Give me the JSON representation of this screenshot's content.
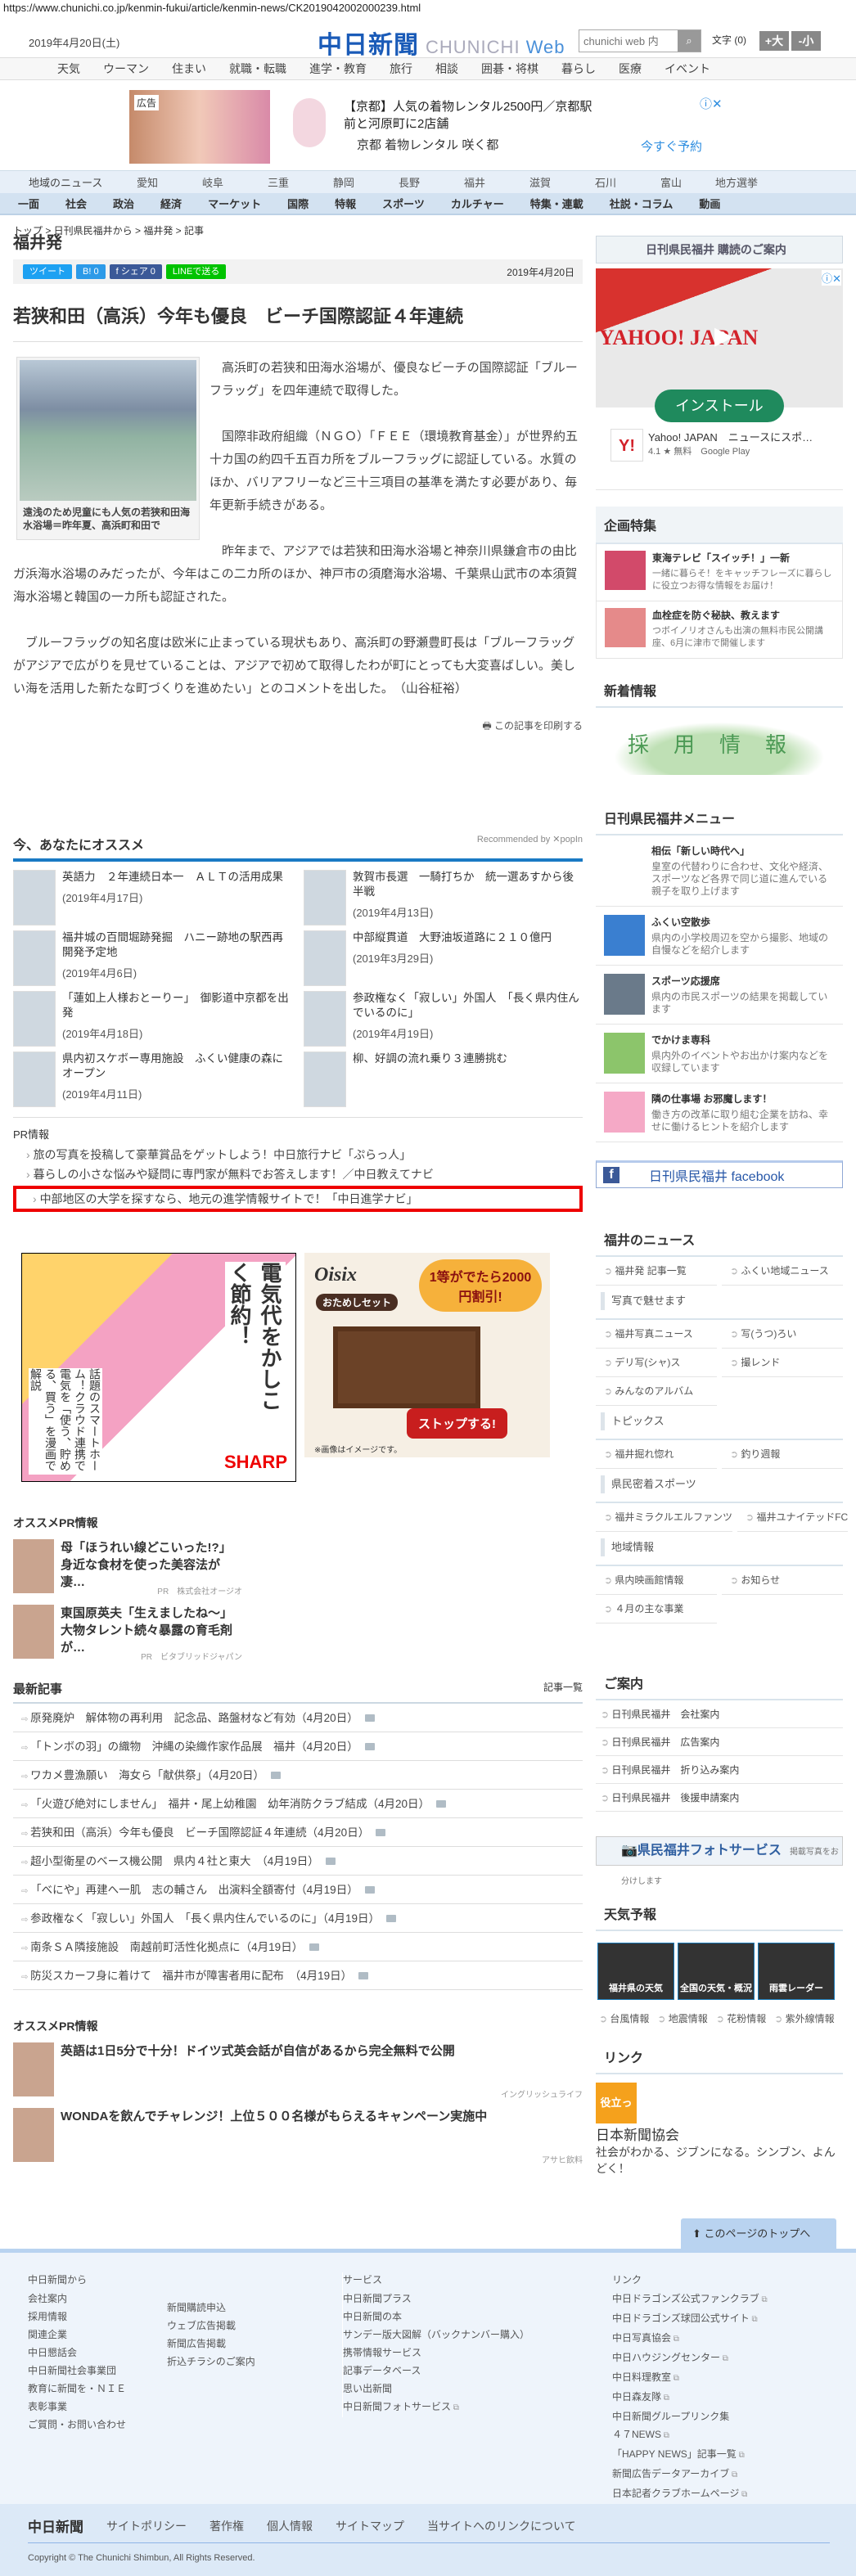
{
  "url": "https://www.chunichi.co.jp/kenmin-fukui/article/kenmin-news/CK2019042002000239.html",
  "header": {
    "date": "2019年4月20日(土)",
    "logo": "中日新聞",
    "logo_sub": "CHUNICHI",
    "logo_web": "Web",
    "search_placeholder": "chunichi web 内",
    "font_label": "文字 (0)",
    "bigger": "+大",
    "smaller": "-小"
  },
  "top_nav": [
    "天気",
    "ウーマン",
    "住まい",
    "就職・転職",
    "進学・教育",
    "旅行",
    "相談",
    "囲碁・将棋",
    "暮らし",
    "医療",
    "イベント"
  ],
  "top_ad": {
    "badge": "広告",
    "text": "【京都】人気の着物レンタル2500円／京都駅前と河原町に2店舗",
    "advertiser": "京都 着物レンタル 咲く都",
    "cta": "今すぐ予約"
  },
  "region_nav": {
    "label": "地域のニュース",
    "items": [
      "愛知",
      "岐阜",
      "三重",
      "静岡",
      "長野",
      "福井",
      "滋賀",
      "石川",
      "富山",
      "地方選挙"
    ]
  },
  "category_nav": [
    "一面",
    "社会",
    "政治",
    "経済",
    "マーケット",
    "国際",
    "特報",
    "スポーツ",
    "カルチャー",
    "特集・連載",
    "社説・コラム",
    "動画"
  ],
  "breadcrumb": "トップ > 日刊県民福井から > 福井発 > 記事",
  "section_title": "福井発",
  "share": {
    "tweet": "ツイート",
    "hatena": "B! 0",
    "facebook": "f シェア 0",
    "line": "LINEで送る",
    "date": "2019年4月20日"
  },
  "article": {
    "title": "若狭和田（高浜）今年も優良　ビーチ国際認証４年連続",
    "caption": "遠浅のため児童にも人気の若狭和田海水浴場＝昨年夏、高浜町和田で",
    "paragraphs": [
      "高浜町の若狭和田海水浴場が、優良なビーチの国際認証「ブルーフラッグ」を四年連続で取得した。",
      "国際非政府組織（ＮＧＯ）「ＦＥＥ（環境教育基金）」が世界約五十カ国の約四千五百カ所をブルーフラッグに認証している。水質のほか、バリアフリーなど三十三項目の基準を満たす必要があり、毎年更新手続きがある。",
      "昨年まで、アジアでは若狭和田海水浴場と神奈川県鎌倉市の由比ガ浜海水浴場のみだったが、今年はこの二カ所のほか、神戸市の須磨海水浴場、千葉県山武市の本須賀海水浴場と韓国の一カ所も認証された。",
      "ブルーフラッグの知名度は欧米に止まっている現状もあり、高浜町の野瀬豊町長は「ブルーフラッグがアジアで広がりを見せていることは、アジアで初めて取得したわが町にとっても大変喜ばしい。美しい海を活用した新たな町づくりを進めたい」とのコメントを出した。　（山谷柾裕）"
    ],
    "print": "この記事を印刷する"
  },
  "recommend": {
    "title": "今、あなたにオススメ",
    "by": "Recommended by ✕popIn",
    "items": [
      {
        "title": "英語力　２年連続日本一　ＡＬＴの活用成果",
        "date": "(2019年4月17日)"
      },
      {
        "title": "敦賀市長選　一騎打ちか　統一選あすから後半戦",
        "date": "(2019年4月13日)"
      },
      {
        "title": "福井城の百間堀跡発掘　ハニー跡地の駅西再開発予定地",
        "date": "(2019年4月6日)"
      },
      {
        "title": "中部縦貫道　大野油坂道路に２１０億円",
        "date": "(2019年3月29日)"
      },
      {
        "title": "「蓮如上人様おとーりー」　御影道中京都を出発",
        "date": "(2019年4月18日)"
      },
      {
        "title": "参政権なく「寂しい」外国人　「長く県内住んでいるのに」",
        "date": "(2019年4月19日)"
      },
      {
        "title": "県内初スケボー専用施設　ふくい健康の森にオープン",
        "date": "(2019年4月11日)"
      },
      {
        "title": "柳、好調の流れ乗り３連勝挑む",
        "date": ""
      }
    ]
  },
  "pr_info": {
    "label": "PR情報",
    "items": [
      "旅の写真を投稿して豪華賞品をゲットしよう！中日旅行ナビ「ぷらっ人」",
      "暮らしの小さな悩みや疑問に専門家が無料でお答えします！／中日教えてナビ",
      "中部地区の大学を探すなら、地元の進学情報サイトで！「中日進学ナビ」"
    ]
  },
  "display_ads": {
    "sharp": {
      "headline": "電気代をかしこく節約！",
      "body": "話題のスマートホーム！クラウド連携で電気を「使う、貯める、買う」を漫画で解説",
      "brand": "SHARP"
    },
    "oisix": {
      "brand": "Oisix",
      "set": "おためしセット",
      "promo": "1等がでたら2000円割引!",
      "button": "ストップする!",
      "note": "※画像はイメージです。"
    }
  },
  "pr_recommend_1": {
    "title": "オススメPR情報",
    "items": [
      {
        "title": "母「ほうれい線どこいった!?」身近な食材を使った美容法が凄…",
        "source": "PR　株式会社オージオ"
      },
      {
        "title": "東国原英夫「生えましたね～」大物タレント続々暴露の育毛剤が…",
        "source": "PR　ビタブリッドジャパン"
      }
    ]
  },
  "latest": {
    "title": "最新記事",
    "more": "記事一覧",
    "items": [
      "原発廃炉　解体物の再利用　記念品、路盤材など有効（4月20日）",
      "「トンボの羽」の織物　沖縄の染織作家作品展　福井（4月20日）",
      "ワカメ豊漁願い　海女ら「献供祭」（4月20日）",
      "「火遊び絶対にしません」　福井・尾上幼稚園　幼年消防クラブ結成（4月20日）",
      "若狭和田（高浜）今年も優良　ビーチ国際認証４年連続（4月20日）",
      "超小型衛星のベース機公開　県内４社と東大　（4月19日）",
      "「べにや」再建へ一肌　志の輔さん　出演料全額寄付（4月19日）",
      "参政権なく「寂しい」外国人　「長く県内住んでいるのに」（4月19日）",
      "南条ＳＡ隣接施設　南越前町活性化拠点に（4月19日）",
      "防災スカーフ身に着けて　福井市が障害者用に配布　（4月19日）"
    ]
  },
  "pr_recommend_2": {
    "title": "オススメPR情報",
    "items": [
      {
        "title": "英語は1日5分で十分！ドイツ式英会話が自信があるから完全無料で公開",
        "source": "イングリッシュライフ"
      },
      {
        "title": "WONDAを飲んでチャレンジ！上位５００名様がもらえるキャンペーン実施中",
        "source": "アサヒ飲料"
      }
    ]
  },
  "sidebar": {
    "subscribe": "日刊県民福井 購読のご案内",
    "yahoo_ad": {
      "logo": "YAHOO! JAPAN",
      "install": "インストール",
      "app": "Yahoo! JAPAN　ニュースにスポ…",
      "rating": "4.1 ★ 無料",
      "store": "Google Play"
    },
    "features": {
      "title": "企画特集",
      "items": [
        {
          "title": "東海テレビ「スイッチ！」一新",
          "desc": "一緒に暮らそ！をキャッチフレーズに暮らしに役立つお得な情報をお届け！"
        },
        {
          "title": "血栓症を防ぐ秘訣、教えます",
          "desc": "つボイノリオさんも出演の無料市民公開講座、6月に津市で開催します"
        }
      ]
    },
    "new_info": {
      "title": "新着情報",
      "banner": "採用情報"
    },
    "menu": {
      "title": "日刊県民福井メニュー",
      "items": [
        {
          "title": "相伝「新しい時代へ」",
          "desc": "皇室の代替わりに合わせ、文化や経済、スポーツなど各界で同じ道に進んでいる親子を取り上げます"
        },
        {
          "title": "ふくい空散歩",
          "desc": "県内の小学校周辺を空から撮影、地域の自慢などを紹介します"
        },
        {
          "title": "スポーツ応援席",
          "desc": "県内の市民スポーツの結果を掲載しています"
        },
        {
          "title": "でかけま専科",
          "desc": "県内外のイベントやお出かけ案内などを収録しています"
        },
        {
          "title": "隣の仕事場 お邪魔します！",
          "desc": "働き方の改革に取り組む企業を訪ね、幸せに働けるヒントを紹介します"
        }
      ]
    },
    "facebook": "日刊県民福井 facebook",
    "fukui_news": {
      "title": "福井のニュース",
      "top": [
        "福井発 記事一覧",
        "ふくい地域ニュース"
      ],
      "groups": [
        {
          "title": "写真で魅せます",
          "items": [
            "福井写真ニュース",
            "写(うつ)ろい",
            "デリ写(シャ)ス",
            "撮レンド",
            "みんなのアルバム"
          ]
        },
        {
          "title": "トピックス",
          "items": [
            "福井掘れ惚れ",
            "釣り週報"
          ]
        },
        {
          "title": "県民密着スポーツ",
          "items": [
            "福井ミラクルエルファンツ",
            "福井ユナイテッドFC"
          ]
        },
        {
          "title": "地域情報",
          "items": [
            "県内映画館情報",
            "お知らせ",
            "４月の主な事業"
          ]
        }
      ]
    },
    "guide": {
      "title": "ご案内",
      "items": [
        "日刊県民福井　会社案内",
        "日刊県民福井　広告案内",
        "日刊県民福井　折り込み案内",
        "日刊県民福井　後援申請案内"
      ]
    },
    "photo_service": {
      "title": "県民福井フォトサービス",
      "sub": "掲載写真をお分けします"
    },
    "weather": {
      "title": "天気予報",
      "tiles": [
        "福井県の天気",
        "全国の天気・概況",
        "雨雲レーダー"
      ],
      "links": [
        "台風情報",
        "地震情報",
        "花粉情報",
        "紫外線情報"
      ]
    },
    "links": {
      "title": "リンク",
      "badge": "役立った",
      "name": "日本新聞協会",
      "desc": "社会がわかる、ジブンになる。シンブン、よんどく！"
    }
  },
  "to_top": "このページのトップへ",
  "footer": {
    "col1": {
      "title": "中日新聞から",
      "a": [
        "会社案内",
        "採用情報",
        "関連企業",
        "中日懇話会",
        "中日新聞社会事業団",
        "教育に新聞を・ＮＩＥ",
        "表彰事業",
        "ご質問・お問い合わせ"
      ],
      "b": [
        "新聞購読申込",
        "ウェブ広告掲載",
        "新聞広告掲載",
        "折込チラシのご案内"
      ]
    },
    "col2": {
      "title": "サービス",
      "items": [
        "中日新聞プラス",
        "中日新聞の本",
        "サンデー版大図解（バックナンバー購入）",
        "携帯情報サービス",
        "記事データベース",
        "思い出新聞",
        "中日新聞フォトサービス"
      ]
    },
    "col3": {
      "title": "リンク",
      "items": [
        "中日ドラゴンズ公式ファンクラブ",
        "中日ドラゴンズ球団公式サイト",
        "中日写真協会",
        "中日ハウジングセンター",
        "中日料理教室",
        "中日森友隊",
        "中日新聞グループリンク集",
        "４７NEWS",
        "「HAPPY NEWS」記事一覧",
        "新聞広告データアーカイブ",
        "日本記者クラブホームページ"
      ]
    },
    "bottom_logo": "中日新聞",
    "bottom_links": [
      "サイトポリシー",
      "著作権",
      "個人情報",
      "サイトマップ",
      "当サイトへのリンクについて"
    ],
    "copyright": "Copyright © The Chunichi Shimbun, All Rights Reserved."
  },
  "colors": {
    "brand": "#1a5bb8",
    "accent": "#1a7ac4",
    "highlight": "#ee0000"
  }
}
